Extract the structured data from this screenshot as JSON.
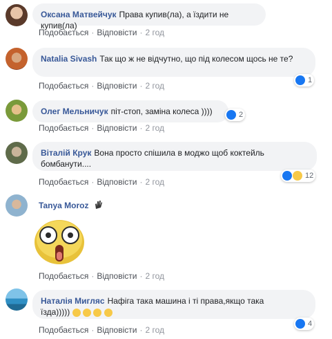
{
  "actions": {
    "like": "Подобається",
    "reply": "Відповісти",
    "separator": "·"
  },
  "comments": [
    {
      "author": "Оксана Матвейчук",
      "text": "Права купив(ла), а їздити не купив(ла)",
      "time": "2 год"
    },
    {
      "author": "Natalia Sivash",
      "text": "Так що ж не відчутно, що під колесом щось не те?",
      "time": "2 год",
      "reactions": {
        "count": "1"
      }
    },
    {
      "author": "Олег Мельничук",
      "text": "піт-стоп, заміна колеса ))))",
      "time": "2 год",
      "reactions": {
        "count": "2"
      }
    },
    {
      "author": "Віталій Крук",
      "text": "Вона просто спішила в моджо щоб коктейль бомбанути....",
      "time": "2 год",
      "reactions": {
        "count": "12"
      }
    },
    {
      "author": "Tanya Moroz",
      "time": "2 год",
      "sticker": "shocked-face-sticker"
    },
    {
      "author": "Наталія Мигляс",
      "text": "Нафіга така машина і ті права,якщо така їзда)))))",
      "time": "2 год",
      "reactions": {
        "count": "4"
      }
    }
  ],
  "colors": {
    "author": "#385898",
    "bubble": "#f2f3f5",
    "like": "#1877f2",
    "meta": "#90949c"
  }
}
